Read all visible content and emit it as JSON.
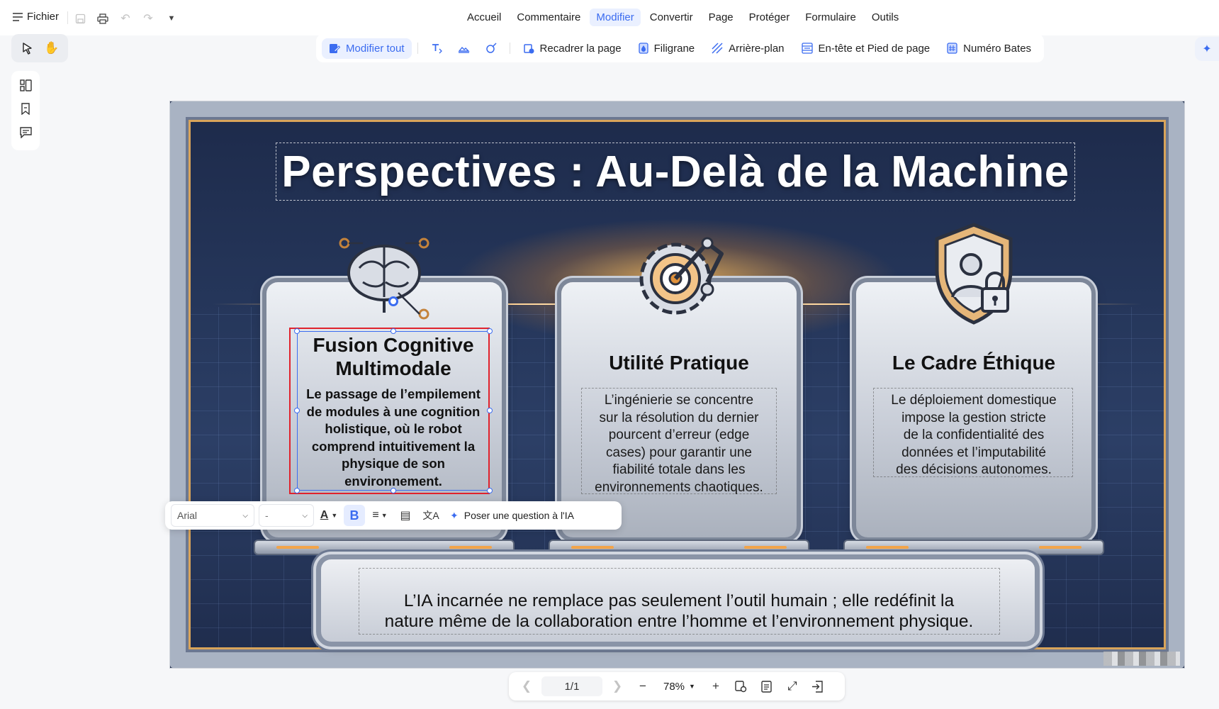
{
  "menu": {
    "file_label": "Fichier",
    "items": [
      {
        "label": "Accueil",
        "active": false
      },
      {
        "label": "Commentaire",
        "active": false
      },
      {
        "label": "Modifier",
        "active": true
      },
      {
        "label": "Convertir",
        "active": false
      },
      {
        "label": "Page",
        "active": false
      },
      {
        "label": "Protéger",
        "active": false
      },
      {
        "label": "Formulaire",
        "active": false
      },
      {
        "label": "Outils",
        "active": false
      }
    ]
  },
  "ribbon": {
    "edit_all": "Modifier tout",
    "crop": "Recadrer la page",
    "watermark": "Filigrane",
    "background": "Arrière-plan",
    "header_footer": "En-tête et Pied de page",
    "bates": "Numéro Bates"
  },
  "document": {
    "title": "Perspectives : Au-Delà de la Machine",
    "cards": [
      {
        "title_line1": "Fusion Cognitive",
        "title_line2": "Multimodale",
        "body": [
          "Le passage de l’empilement",
          "de modules à une cognition",
          "holistique, où le robot",
          "comprend intuitivement la",
          "physique de son",
          "environnement."
        ]
      },
      {
        "title": "Utilité Pratique",
        "body": [
          "L’ingénierie se concentre",
          "sur la résolution du dernier",
          "pourcent d’erreur (edge",
          "cases) pour garantir une",
          "fiabilité totale dans les",
          "environnements chaotiques."
        ]
      },
      {
        "title": "Le Cadre Éthique",
        "body": [
          "Le déploiement domestique",
          "impose la gestion stricte",
          "de la confidentialité des",
          "données et l’imputabilité",
          "des décisions autonomes."
        ]
      }
    ],
    "banner": [
      "L’IA incarnée ne remplace pas seulement l’outil humain ; elle redéfinit la",
      "nature même de la collaboration entre l’homme et l’environnement physique."
    ]
  },
  "format_bar": {
    "font": "Arial",
    "size": "-",
    "ask_ai": "Poser une question à l'IA"
  },
  "nav": {
    "page": "1/1",
    "zoom": "78%"
  },
  "colors": {
    "accent": "#3b6cf0",
    "selection_red": "#e0222c"
  }
}
